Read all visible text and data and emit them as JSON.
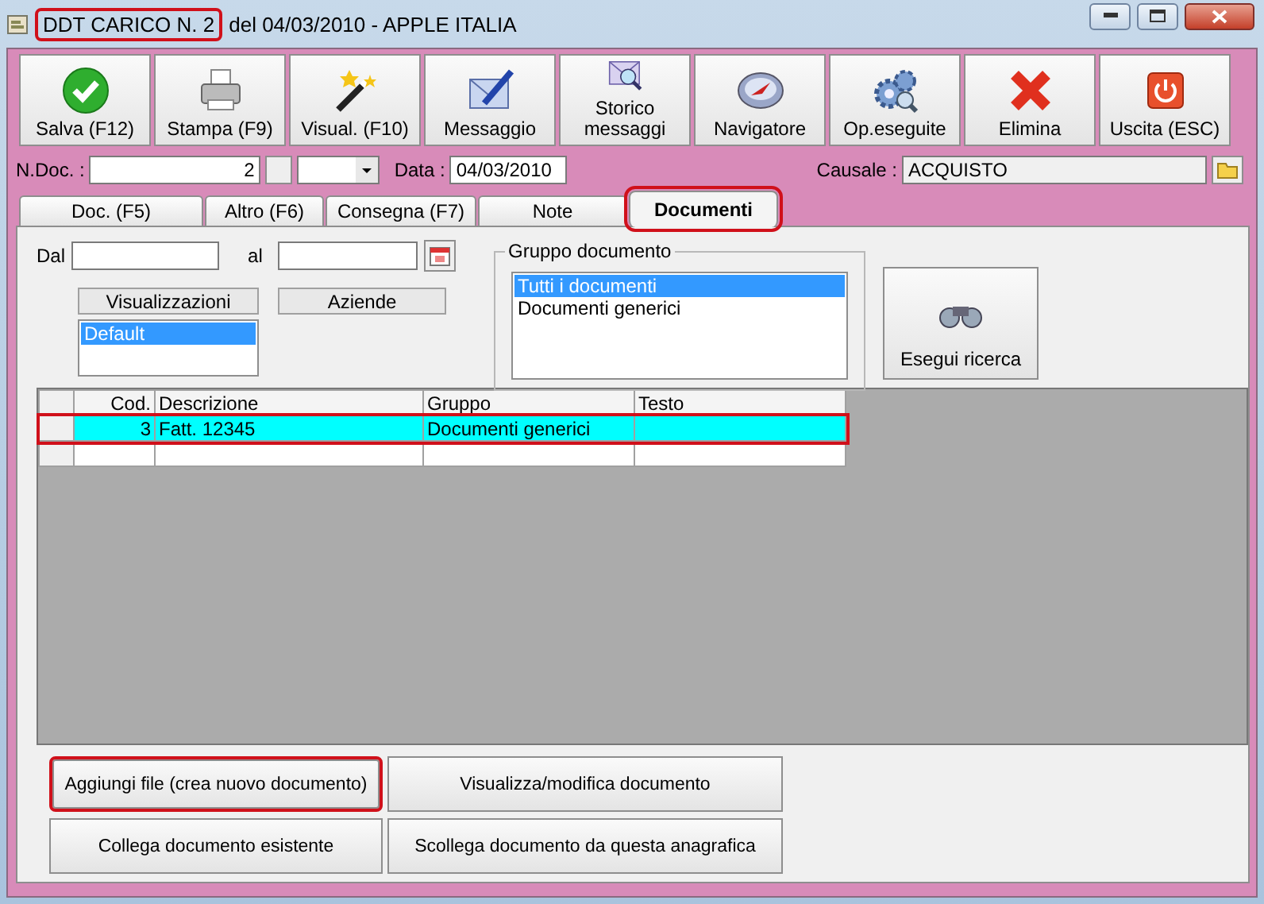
{
  "window": {
    "title": "DDT CARICO N. 2",
    "subtitle": "del 04/03/2010 - APPLE ITALIA",
    "title_highlighted": true
  },
  "toolbar": [
    {
      "kind": "check",
      "label": "Salva (F12)"
    },
    {
      "kind": "printer",
      "label": "Stampa (F9)"
    },
    {
      "kind": "wand",
      "label": "Visual. (F10)"
    },
    {
      "kind": "mail-pen",
      "label": "Messaggio"
    },
    {
      "kind": "mail-search",
      "label": "Storico\nmessaggi"
    },
    {
      "kind": "compass",
      "label": "Navigatore"
    },
    {
      "kind": "gears",
      "label": "Op.eseguite"
    },
    {
      "kind": "cross",
      "label": "Elimina"
    },
    {
      "kind": "power",
      "label": "Uscita (ESC)"
    }
  ],
  "header": {
    "doc_label": "N.Doc. :",
    "doc_value": "2",
    "date_label": "Data :",
    "date_value": "04/03/2010",
    "causale_label": "Causale :",
    "causale_value": "ACQUISTO"
  },
  "tabs": [
    {
      "label": "Doc. (F5)",
      "selected": false,
      "highlighted": false
    },
    {
      "label": "Altro (F6)",
      "selected": false,
      "highlighted": false
    },
    {
      "label": "Consegna (F7)",
      "selected": false,
      "highlighted": false
    },
    {
      "label": "Note",
      "selected": false,
      "highlighted": false
    },
    {
      "label": "Documenti",
      "selected": true,
      "highlighted": true
    }
  ],
  "filters": {
    "from_label": "Dal",
    "to_label": "al",
    "views_header": "Visualizzazioni",
    "companies_header": "Aziende",
    "views": [
      {
        "label": "Default",
        "selected": true
      }
    ],
    "group_title": "Gruppo documento",
    "groups": [
      {
        "label": "Tutti i documenti",
        "selected": true
      },
      {
        "label": "Documenti generici",
        "selected": false
      }
    ],
    "search_button": "Esegui ricerca"
  },
  "table": {
    "columns": [
      "Cod.",
      "Descrizione",
      "Gruppo",
      "Testo"
    ],
    "rows": [
      {
        "cells": [
          "3",
          "Fatt. 12345",
          "Documenti generici"
        ],
        "selected": true,
        "highlighted": true
      }
    ]
  },
  "actions": [
    {
      "label": "Aggiungi file (crea nuovo documento)",
      "highlighted": true
    },
    {
      "label": "Visualizza/modifica documento",
      "highlighted": false
    },
    {
      "label": "Collega documento esistente",
      "highlighted": false
    },
    {
      "label": "Scollega documento da questa anagrafica",
      "highlighted": false
    }
  ]
}
